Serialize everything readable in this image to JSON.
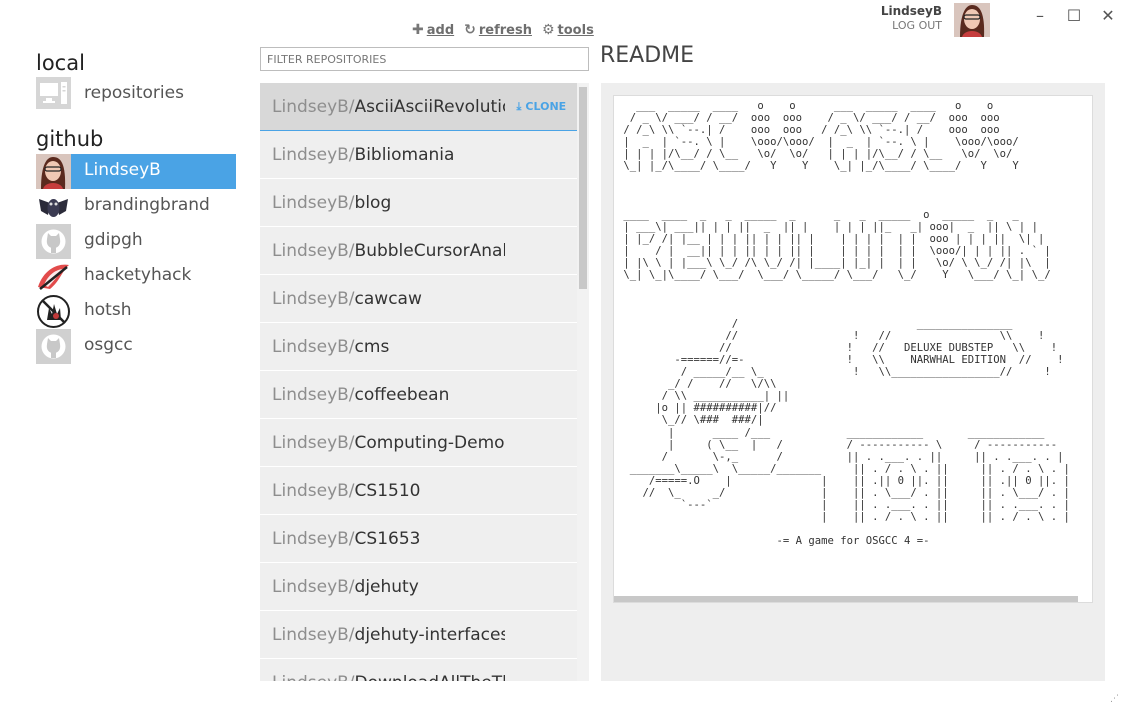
{
  "toolbar": {
    "add_icon": "plus-icon",
    "add_label": "add",
    "refresh_icon": "refresh-icon",
    "refresh_label": "refresh",
    "tools_icon": "gear-icon",
    "tools_label": "tools"
  },
  "user": {
    "name": "LindseyB",
    "logout_label": "LOG OUT"
  },
  "window_controls": {
    "minimize": "–",
    "maximize": "☐",
    "close": "✕"
  },
  "sidebar": {
    "local_title": "local",
    "local_items": [
      {
        "label": "repositories",
        "icon": "computer-icon"
      }
    ],
    "github_title": "github",
    "github_items": [
      {
        "label": "LindseyB",
        "active": true
      },
      {
        "label": "brandingbrand",
        "active": false
      },
      {
        "label": "gdipgh",
        "active": false
      },
      {
        "label": "hacketyhack",
        "active": false
      },
      {
        "label": "hotsh",
        "active": false
      },
      {
        "label": "osgcc",
        "active": false
      }
    ]
  },
  "filter": {
    "placeholder": "FILTER REPOSITORIES"
  },
  "repos": {
    "owner_prefix": "LindseyB/",
    "clone_label": "CLONE",
    "clone_icon": "download-icon",
    "items": [
      {
        "name": "AsciiAsciiRevolution",
        "selected": true
      },
      {
        "name": "Bibliomania"
      },
      {
        "name": "blog"
      },
      {
        "name": "BubbleCursorAnaly"
      },
      {
        "name": "cawcaw"
      },
      {
        "name": "cms"
      },
      {
        "name": "coffeebean"
      },
      {
        "name": "Computing-Democ"
      },
      {
        "name": "CS1510"
      },
      {
        "name": "CS1653"
      },
      {
        "name": "djehuty"
      },
      {
        "name": "djehuty-interfaces"
      },
      {
        "name": "DownloadAllTheTh"
      }
    ]
  },
  "readme": {
    "title": "README",
    "lines": [
      "   ___  _____  ____   o    o      ___  _____  ____   o    o",
      "  / _ \\/ ___/ / __/  ooo  ooo    / _ \\/ ___/ / __/  ooo  ooo",
      " / /_\\ \\\\ `--.| /    ooo  ooo   / /_\\ \\\\ `--.| /    ooo  ooo",
      " |  _  | `--. \\ |    \\ooo/\\ooo/  |  _  | `--. \\ |    \\ooo/\\ooo/",
      " | | | |/\\__/ / \\__   \\o/  \\o/   | | | |/\\__/ / \\__   \\o/  \\o/",
      " \\_| |_/\\____/ \\____/   Y    Y    \\_| |_/\\____/ \\____/   Y    Y",
      "",
      "",
      "",
      " ____  ____  _   _  _____  _      _   _  _____  o  _____  _   _",
      " | ___\\| ___|| | | ||  _  || |    | | | ||_   _| ooo|  _  || \\ | |",
      " | |_/ /| |__ | | | || | | || |    | | | |  | |  ooo | | | ||  \\| |",
      " |    / |  __|| | | || | | || |    | | | |  | |  \\ooo/| | | || . ` |",
      " | |\\ \\ | |___\\ \\_/ /\\ \\_/ /| |____| |_| |  | |   \\o/ \\ \\_/ /| |\\  |",
      " \\_| \\_|\\____/ \\___/  \\___/ \\_____/ \\___/   \\_/    Y   \\___/ \\_| \\_/",
      "",
      "",
      "",
      "                  /                            _______________",
      "                 //                  !   //                 \\\\    !",
      "                //                  !   //   DELUXE DUBSTEP   \\\\    !",
      "         -======//=-                !   \\\\    NARWHAL EDITION  //    !",
      "          / _____/__ \\_              !   \\\\_________________//     !",
      "        _/ /    //   \\/\\\\",
      "       / \\\\ ___________| ||",
      "      |o || ##########|//",
      "       \\_// \\###  ###/|",
      "        |      ____ /___            ____________       ____________",
      "        |     ( \\__  |   /          / ----------- \\     / -----------",
      "       /       \\-,_      /          || . .___. . ||     || . .___. . |",
      "  _______\\_____\\  \\_____/_______     || . / . \\ . ||     || . / . \\ . |",
      "     /=====.O    |              |    || .|| 0 ||. ||     || .|| 0 ||. |",
      "    //  \\_     _/               |    || . \\___/ . ||     || . \\___/ . |",
      "          `---`                 |    || . .___. . ||     || . .___. . |",
      "                                |    || . / . \\ . ||     || . / . \\ . |",
      "",
      "                         -= A game for OSGCC 4 =-"
    ]
  }
}
